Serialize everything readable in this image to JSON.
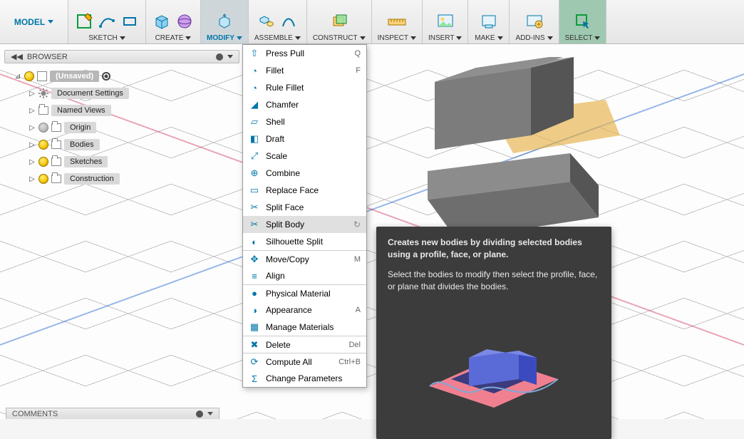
{
  "workspace": {
    "label": "MODEL"
  },
  "toolbar": {
    "groups": [
      {
        "id": "sketch",
        "label": "SKETCH"
      },
      {
        "id": "create",
        "label": "CREATE"
      },
      {
        "id": "modify",
        "label": "MODIFY",
        "active": true
      },
      {
        "id": "assemble",
        "label": "ASSEMBLE"
      },
      {
        "id": "construct",
        "label": "CONSTRUCT"
      },
      {
        "id": "inspect",
        "label": "INSPECT"
      },
      {
        "id": "insert",
        "label": "INSERT"
      },
      {
        "id": "make",
        "label": "MAKE"
      },
      {
        "id": "addins",
        "label": "ADD-INS"
      },
      {
        "id": "select",
        "label": "SELECT"
      }
    ]
  },
  "browser": {
    "title": "BROWSER",
    "root": {
      "label": "(Unsaved)"
    },
    "items": [
      {
        "label": "Document Settings",
        "icon": "gear",
        "bulb": false
      },
      {
        "label": "Named Views",
        "icon": "folder",
        "bulb": false
      },
      {
        "label": "Origin",
        "icon": "folder",
        "bulb": "off"
      },
      {
        "label": "Bodies",
        "icon": "folder",
        "bulb": "on"
      },
      {
        "label": "Sketches",
        "icon": "folder",
        "bulb": "on"
      },
      {
        "label": "Construction",
        "icon": "folder",
        "bulb": "on"
      }
    ]
  },
  "menu": {
    "items": [
      {
        "label": "Press Pull",
        "shortcut": "Q"
      },
      {
        "label": "Fillet",
        "shortcut": "F"
      },
      {
        "label": "Rule Fillet"
      },
      {
        "label": "Chamfer"
      },
      {
        "label": "Shell"
      },
      {
        "label": "Draft"
      },
      {
        "label": "Scale"
      },
      {
        "label": "Combine"
      },
      {
        "label": "Replace Face"
      },
      {
        "label": "Split Face"
      },
      {
        "label": "Split Body",
        "hover": true,
        "arrow": true
      },
      {
        "label": "Silhouette Split"
      },
      {
        "label": "Move/Copy",
        "shortcut": "M",
        "sep": true
      },
      {
        "label": "Align"
      },
      {
        "label": "Physical Material",
        "sep": true
      },
      {
        "label": "Appearance",
        "shortcut": "A"
      },
      {
        "label": "Manage Materials"
      },
      {
        "label": "Delete",
        "shortcut": "Del",
        "sep": true
      },
      {
        "label": "Compute All",
        "shortcut": "Ctrl+B",
        "sep": true
      },
      {
        "label": "Change Parameters"
      }
    ]
  },
  "tooltip": {
    "p1": "Creates new bodies by dividing selected bodies using a profile, face, or plane.",
    "p2": "Select the bodies to modify then select the profile, face, or plane that divides the bodies."
  },
  "comments": {
    "label": "COMMENTS"
  }
}
